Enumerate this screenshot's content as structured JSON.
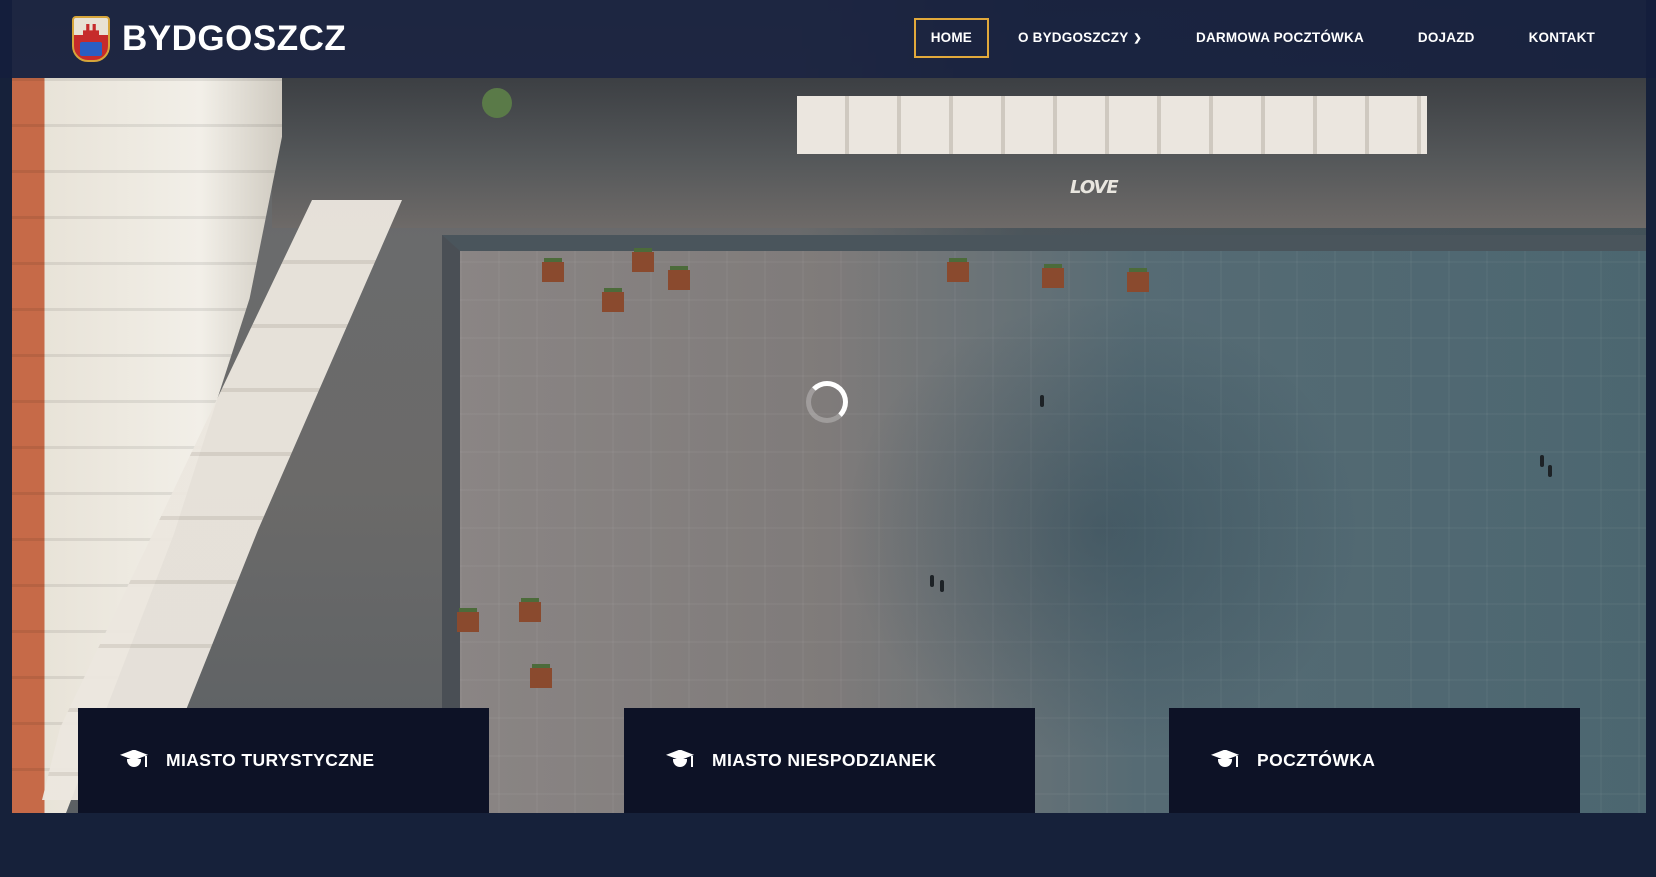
{
  "brand": {
    "name": "BYDGOSZCZ",
    "crest_icon": "city-coat-of-arms-icon"
  },
  "nav": {
    "items": [
      {
        "label": "HOME",
        "active": true
      },
      {
        "label": "O BYDGOSZCZY",
        "has_dropdown": true
      },
      {
        "label": "DARMOWA POCZTÓWKA"
      },
      {
        "label": "DOJAZD"
      },
      {
        "label": "KONTAKT"
      }
    ]
  },
  "hero": {
    "sign_text": "LOVE",
    "loading": true
  },
  "cards": [
    {
      "label": "MIASTO TURYSTYCZNE",
      "icon": "graduation-cap-icon"
    },
    {
      "label": "MIASTO NIESPODZIANEK",
      "icon": "graduation-cap-icon"
    },
    {
      "label": "POCZTÓWKA",
      "icon": "graduation-cap-icon"
    }
  ],
  "colors": {
    "header_bg": "#141e3c",
    "page_bg": "#16213a",
    "card_bg": "#0d1226",
    "accent": "#e2a93b",
    "text": "#ffffff"
  }
}
